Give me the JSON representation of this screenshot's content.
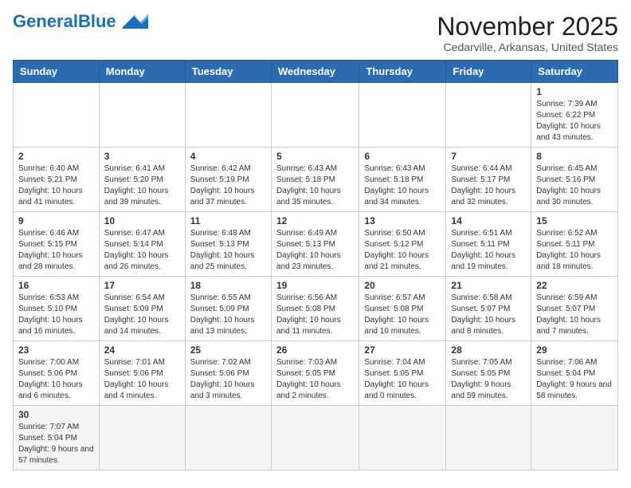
{
  "logo": {
    "text_black": "General",
    "text_blue": "Blue"
  },
  "header": {
    "month": "November 2025",
    "location": "Cedarville, Arkansas, United States"
  },
  "days_of_week": [
    "Sunday",
    "Monday",
    "Tuesday",
    "Wednesday",
    "Thursday",
    "Friday",
    "Saturday"
  ],
  "weeks": [
    [
      {
        "day": "",
        "info": ""
      },
      {
        "day": "",
        "info": ""
      },
      {
        "day": "",
        "info": ""
      },
      {
        "day": "",
        "info": ""
      },
      {
        "day": "",
        "info": ""
      },
      {
        "day": "",
        "info": ""
      },
      {
        "day": "1",
        "info": "Sunrise: 7:39 AM\nSunset: 6:22 PM\nDaylight: 10 hours and 43 minutes."
      }
    ],
    [
      {
        "day": "2",
        "info": "Sunrise: 6:40 AM\nSunset: 5:21 PM\nDaylight: 10 hours and 41 minutes."
      },
      {
        "day": "3",
        "info": "Sunrise: 6:41 AM\nSunset: 5:20 PM\nDaylight: 10 hours and 39 minutes."
      },
      {
        "day": "4",
        "info": "Sunrise: 6:42 AM\nSunset: 5:19 PM\nDaylight: 10 hours and 37 minutes."
      },
      {
        "day": "5",
        "info": "Sunrise: 6:43 AM\nSunset: 5:18 PM\nDaylight: 10 hours and 35 minutes."
      },
      {
        "day": "6",
        "info": "Sunrise: 6:43 AM\nSunset: 5:18 PM\nDaylight: 10 hours and 34 minutes."
      },
      {
        "day": "7",
        "info": "Sunrise: 6:44 AM\nSunset: 5:17 PM\nDaylight: 10 hours and 32 minutes."
      },
      {
        "day": "8",
        "info": "Sunrise: 6:45 AM\nSunset: 5:16 PM\nDaylight: 10 hours and 30 minutes."
      }
    ],
    [
      {
        "day": "9",
        "info": "Sunrise: 6:46 AM\nSunset: 5:15 PM\nDaylight: 10 hours and 28 minutes."
      },
      {
        "day": "10",
        "info": "Sunrise: 6:47 AM\nSunset: 5:14 PM\nDaylight: 10 hours and 26 minutes."
      },
      {
        "day": "11",
        "info": "Sunrise: 6:48 AM\nSunset: 5:13 PM\nDaylight: 10 hours and 25 minutes."
      },
      {
        "day": "12",
        "info": "Sunrise: 6:49 AM\nSunset: 5:13 PM\nDaylight: 10 hours and 23 minutes."
      },
      {
        "day": "13",
        "info": "Sunrise: 6:50 AM\nSunset: 5:12 PM\nDaylight: 10 hours and 21 minutes."
      },
      {
        "day": "14",
        "info": "Sunrise: 6:51 AM\nSunset: 5:11 PM\nDaylight: 10 hours and 19 minutes."
      },
      {
        "day": "15",
        "info": "Sunrise: 6:52 AM\nSunset: 5:11 PM\nDaylight: 10 hours and 18 minutes."
      }
    ],
    [
      {
        "day": "16",
        "info": "Sunrise: 6:53 AM\nSunset: 5:10 PM\nDaylight: 10 hours and 16 minutes."
      },
      {
        "day": "17",
        "info": "Sunrise: 6:54 AM\nSunset: 5:09 PM\nDaylight: 10 hours and 14 minutes."
      },
      {
        "day": "18",
        "info": "Sunrise: 6:55 AM\nSunset: 5:09 PM\nDaylight: 10 hours and 13 minutes."
      },
      {
        "day": "19",
        "info": "Sunrise: 6:56 AM\nSunset: 5:08 PM\nDaylight: 10 hours and 11 minutes."
      },
      {
        "day": "20",
        "info": "Sunrise: 6:57 AM\nSunset: 5:08 PM\nDaylight: 10 hours and 10 minutes."
      },
      {
        "day": "21",
        "info": "Sunrise: 6:58 AM\nSunset: 5:07 PM\nDaylight: 10 hours and 8 minutes."
      },
      {
        "day": "22",
        "info": "Sunrise: 6:59 AM\nSunset: 5:07 PM\nDaylight: 10 hours and 7 minutes."
      }
    ],
    [
      {
        "day": "23",
        "info": "Sunrise: 7:00 AM\nSunset: 5:06 PM\nDaylight: 10 hours and 6 minutes."
      },
      {
        "day": "24",
        "info": "Sunrise: 7:01 AM\nSunset: 5:06 PM\nDaylight: 10 hours and 4 minutes."
      },
      {
        "day": "25",
        "info": "Sunrise: 7:02 AM\nSunset: 5:06 PM\nDaylight: 10 hours and 3 minutes."
      },
      {
        "day": "26",
        "info": "Sunrise: 7:03 AM\nSunset: 5:05 PM\nDaylight: 10 hours and 2 minutes."
      },
      {
        "day": "27",
        "info": "Sunrise: 7:04 AM\nSunset: 5:05 PM\nDaylight: 10 hours and 0 minutes."
      },
      {
        "day": "28",
        "info": "Sunrise: 7:05 AM\nSunset: 5:05 PM\nDaylight: 9 hours and 59 minutes."
      },
      {
        "day": "29",
        "info": "Sunrise: 7:06 AM\nSunset: 5:04 PM\nDaylight: 9 hours and 58 minutes."
      }
    ],
    [
      {
        "day": "30",
        "info": "Sunrise: 7:07 AM\nSunset: 5:04 PM\nDaylight: 9 hours and 57 minutes."
      },
      {
        "day": "",
        "info": ""
      },
      {
        "day": "",
        "info": ""
      },
      {
        "day": "",
        "info": ""
      },
      {
        "day": "",
        "info": ""
      },
      {
        "day": "",
        "info": ""
      },
      {
        "day": "",
        "info": ""
      }
    ]
  ]
}
